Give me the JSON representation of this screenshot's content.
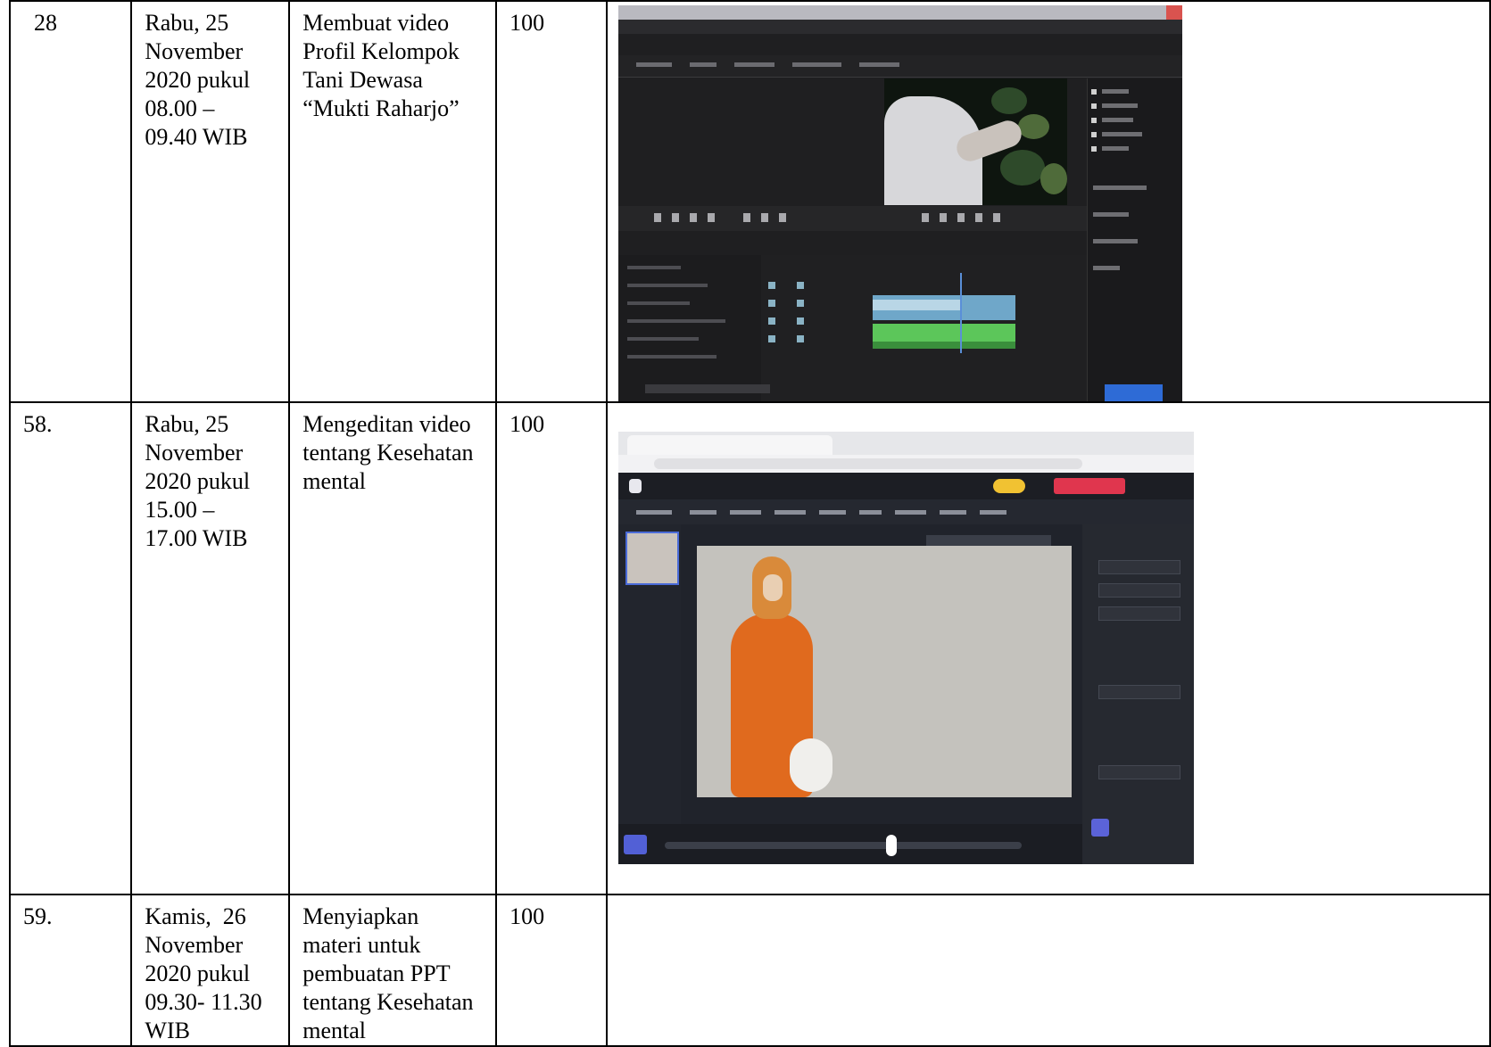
{
  "rows": [
    {
      "no": "28",
      "date_lines": [
        "Rabu, 25",
        "November",
        "2020 pukul",
        "08.00 –",
        "09.40 WIB"
      ],
      "activity_lines": [
        "Membuat video",
        "Profil Kelompok",
        "Tani Dewasa",
        "“Mukti Raharjo”"
      ],
      "percent": "100"
    },
    {
      "no": "58.",
      "date_lines": [
        "Rabu, 25",
        "November",
        "2020 pukul",
        "15.00 –",
        "17.00 WIB"
      ],
      "activity_lines": [
        "Mengeditan video",
        "tentang Kesehatan",
        "mental"
      ],
      "percent": "100"
    },
    {
      "no": "59.",
      "date_lines": [
        "Kamis,  26",
        "November",
        "2020 pukul",
        "09.30- 11.30",
        "WIB"
      ],
      "activity_lines": [
        "Menyiapkan",
        "materi untuk",
        "pembuatan PPT",
        "tentang Kesehatan",
        "mental"
      ],
      "percent": "100"
    }
  ],
  "colors": {
    "editor_bg": "#1f1f21",
    "clip_blue": "#6fa7c9",
    "clip_green": "#5cc65a",
    "web_editor_bg": "#20232b",
    "accent_red": "#e0364e",
    "accent_yellow": "#f1c232"
  }
}
